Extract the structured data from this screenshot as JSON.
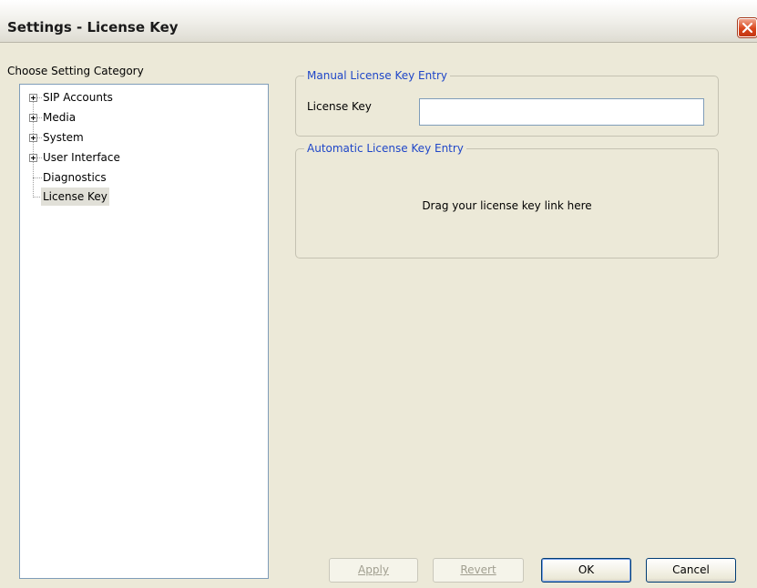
{
  "window": {
    "title": "Settings - License Key",
    "close_icon": "close-icon"
  },
  "sidebar": {
    "heading": "Choose Setting Category",
    "items": [
      {
        "label": "SIP Accounts",
        "expandable": true
      },
      {
        "label": "Media",
        "expandable": true
      },
      {
        "label": "System",
        "expandable": true
      },
      {
        "label": "User Interface",
        "expandable": true
      },
      {
        "label": "Diagnostics",
        "expandable": false
      },
      {
        "label": "License Key",
        "expandable": false,
        "selected": true
      }
    ]
  },
  "manual_entry": {
    "legend": "Manual License Key Entry",
    "field_label": "License Key",
    "value": ""
  },
  "automatic_entry": {
    "legend": "Automatic License Key Entry",
    "drop_text": "Drag your license key link here"
  },
  "buttons": {
    "apply_label": "Apply",
    "revert_label": "Revert",
    "ok_label": "OK",
    "cancel_label": "Cancel"
  },
  "colors": {
    "legend": "#1f46c8",
    "dialog_bg": "#ece9d8",
    "close_button": "#d9461c"
  }
}
